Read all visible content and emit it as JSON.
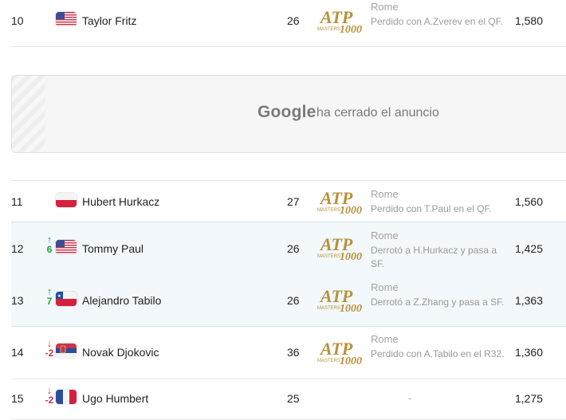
{
  "rows_top": [
    {
      "rank": "10",
      "name": "Taylor Fritz",
      "age": "26",
      "tournament": "Rome",
      "result": "Perdido con A.Zverev en el QF.",
      "points": "1,580",
      "flag": "usa"
    }
  ],
  "ad": {
    "brand": "Google",
    "message": "ha cerrado el anuncio"
  },
  "rows": [
    {
      "rank": "11",
      "move": "",
      "dir": "",
      "name": "Hubert Hurkacz",
      "age": "27",
      "tournament": "Rome",
      "result": "Perdido con T.Paul en el QF.",
      "points": "1,560",
      "flag": "poland"
    },
    {
      "rank": "12",
      "move": "6",
      "dir": "up",
      "name": "Tommy Paul",
      "age": "26",
      "tournament": "Rome",
      "result": "Derrotó a H.Hurkacz y pasa a SF.",
      "points": "1,425",
      "flag": "usa"
    },
    {
      "rank": "13",
      "move": "7",
      "dir": "up",
      "name": "Alejandro Tabilo",
      "age": "26",
      "tournament": "Rome",
      "result": "Derrotó a Z.Zhang y pasa a SF.",
      "points": "1,363",
      "flag": "chile"
    },
    {
      "rank": "14",
      "move": "-2",
      "dir": "down",
      "name": "Novak Djokovic",
      "age": "36",
      "tournament": "Rome",
      "result": "Perdido con A.Tabilo en el R32.",
      "points": "1,360",
      "flag": "serbia"
    },
    {
      "rank": "15",
      "move": "-2",
      "dir": "down",
      "name": "Ugo Humbert",
      "age": "25",
      "tournament": "",
      "result": "-",
      "points": "1,275",
      "flag": "france"
    }
  ],
  "logo": {
    "atp_text": "ATP",
    "masters_text": "MASTERS",
    "number_text": "1000",
    "color": "#b8913a"
  },
  "colors": {
    "up": "#1aab3a",
    "down": "#c8354a"
  }
}
